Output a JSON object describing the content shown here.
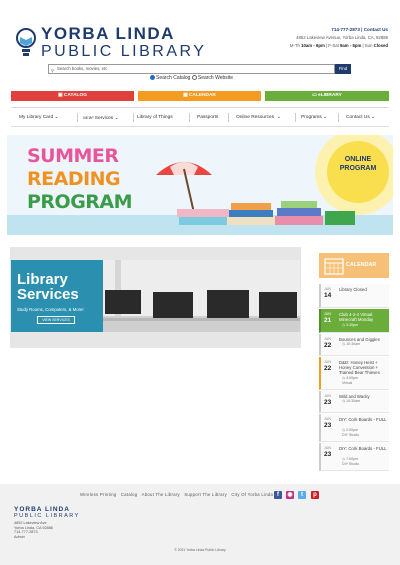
{
  "header": {
    "logo_line1": "YORBA LINDA",
    "logo_line2": "PUBLIC LIBRARY",
    "phone": "714-777-2873 | Contact Us",
    "address": "4852 Lakeview Avenue, Yorba Linda, CA, 92886",
    "hours_prefix": "M-Th",
    "hours_mth": "10am - 6pm",
    "hours_fri": "| F-Sat",
    "hours_fs": "9am - 5pm",
    "hours_sun": "| Sun",
    "hours_closed": "Closed"
  },
  "search": {
    "placeholder": "Search books, movies, etc",
    "find_label": "Find",
    "option_catalog": "Search Catalog",
    "option_website": "Search Website"
  },
  "quick_buttons": {
    "catalog": "CATALOG",
    "calendar": "CALENDAR",
    "elibrary": "eLIBRARY"
  },
  "nav": {
    "items": [
      "My Library Card",
      "Services",
      "Library of Things",
      "Passports",
      "Online Resources",
      "Programs",
      "Contact Us"
    ],
    "new_badge": "NEW!"
  },
  "banner": {
    "line1": "SUMMER",
    "line2": "READING",
    "line3": "PROGRAM",
    "sun_text_1": "ONLINE",
    "sun_text_2": "PROGRAM"
  },
  "promo": {
    "title_1": "Library",
    "title_2": "Services",
    "subtitle": "Study Rooms, Computers, & More!",
    "button": "VIEW SERVICES"
  },
  "calendar": {
    "title": "CALENDAR",
    "events": [
      {
        "month": "JUN",
        "day": "14",
        "title": "Library Closed",
        "time": "",
        "place": ""
      },
      {
        "month": "JUN",
        "day": "21",
        "title": "Club 4-2-4 Virtual Minecraft Monday",
        "time": "3:30pm",
        "place": ""
      },
      {
        "month": "JUN",
        "day": "22",
        "title": "Bounces and Giggles",
        "time": "10:30am",
        "place": ""
      },
      {
        "month": "JUN",
        "day": "22",
        "title": "D&D: Honey Heist + Honey Convention + Trained Bear Thieves",
        "time": "4:00pm",
        "place": "Virtual"
      },
      {
        "month": "JUN",
        "day": "23",
        "title": "Wild and Wacky",
        "time": "10:30am",
        "place": ""
      },
      {
        "month": "JUN",
        "day": "23",
        "title": "DIY: Cork Boards - FULL",
        "time": "2:00pm",
        "place": "DIY Studio"
      },
      {
        "month": "JUN",
        "day": "23",
        "title": "DIY: Cork Boards - FULL",
        "time": "7:00pm",
        "place": "DIY Studio"
      }
    ]
  },
  "footer": {
    "links": [
      "Wireless Printing",
      "Catalog",
      "About The Library",
      "Support The Library",
      "City Of Yorba Linda"
    ],
    "logo_line1": "YORBA LINDA",
    "logo_line2": "PUBLIC LIBRARY",
    "address_1": "4852 Lakeview Ave",
    "address_2": "Yorba Linda, CA 92886",
    "phone": "714-777-2873",
    "admin": "Admin",
    "copyright": "© 2021 Yorba Linda Public Library"
  },
  "colors": {
    "brand": "#1f3b6e",
    "catalog": "#e0413b",
    "calendar": "#f49b22",
    "elibrary": "#6aad3a"
  }
}
